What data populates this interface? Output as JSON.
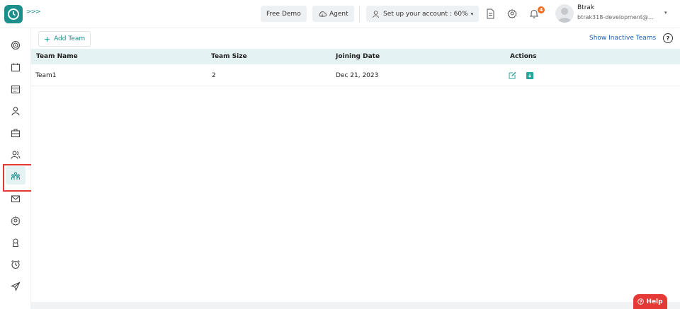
{
  "header": {
    "expand_label": ">>>",
    "free_demo": "Free Demo",
    "agent": "Agent",
    "setup": "Set up your account : 60%",
    "notification_count": "4",
    "user_name": "Btrak",
    "user_email": "btrak318-development@gm..."
  },
  "toolbar": {
    "add_team": "Add Team",
    "show_inactive": "Show Inactive Teams",
    "help_icon": "?"
  },
  "table": {
    "headers": [
      "Team Name",
      "Team Size",
      "Joining Date",
      "Actions"
    ],
    "rows": [
      {
        "name": "Team1",
        "size": "2",
        "date": "Dec 21, 2023"
      }
    ]
  },
  "help_button": "Help",
  "colors": {
    "accent": "#1b8f8c",
    "header_bg": "#e5f2f4",
    "highlight": "#e53935",
    "help": "#e53935"
  },
  "sidebar": {
    "items": [
      "dashboard-icon",
      "calendar-icon",
      "calendar-grid-icon",
      "user-icon",
      "briefcase-icon",
      "users-icon",
      "team-icon",
      "mail-icon",
      "settings-icon",
      "badge-icon",
      "alarm-icon",
      "send-icon"
    ],
    "active": "team-icon"
  }
}
